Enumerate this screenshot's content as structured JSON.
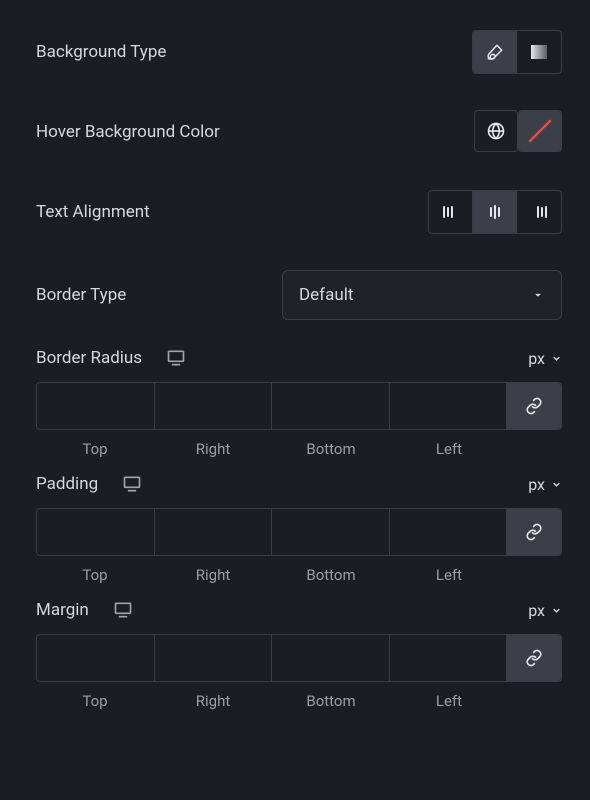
{
  "backgroundType": {
    "label": "Background Type"
  },
  "hoverBgColor": {
    "label": "Hover Background Color"
  },
  "textAlignment": {
    "label": "Text Alignment"
  },
  "borderType": {
    "label": "Border Type",
    "value": "Default"
  },
  "borderRadius": {
    "label": "Border Radius",
    "unit": "px",
    "sides": {
      "top": "Top",
      "right": "Right",
      "bottom": "Bottom",
      "left": "Left"
    },
    "values": {
      "top": "",
      "right": "",
      "bottom": "",
      "left": ""
    }
  },
  "padding": {
    "label": "Padding",
    "unit": "px",
    "sides": {
      "top": "Top",
      "right": "Right",
      "bottom": "Bottom",
      "left": "Left"
    },
    "values": {
      "top": "",
      "right": "",
      "bottom": "",
      "left": ""
    }
  },
  "margin": {
    "label": "Margin",
    "unit": "px",
    "sides": {
      "top": "Top",
      "right": "Right",
      "bottom": "Bottom",
      "left": "Left"
    },
    "values": {
      "top": "",
      "right": "",
      "bottom": "",
      "left": ""
    }
  }
}
